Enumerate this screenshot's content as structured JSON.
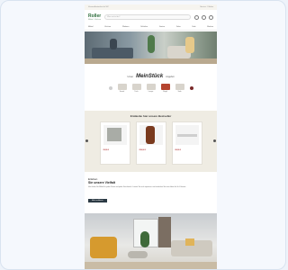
{
  "topbar": {
    "left": "Versandkostenfrei ab 50€",
    "right": "Service · Filialen"
  },
  "header": {
    "logo": "Roller",
    "logo_sub": "Möbel · Küchen",
    "search_placeholder": "Was suchst du?"
  },
  "nav": {
    "items": [
      "Möbel",
      "Küchen",
      "Wohnen",
      "Schlafen",
      "Garten",
      "Deko",
      "Sale",
      "Marken"
    ]
  },
  "brand_section": {
    "pre": "Unser",
    "brand": "MeinStück",
    "post": "Angebot",
    "products": [
      {
        "label": "Sessel"
      },
      {
        "label": "Tisch"
      },
      {
        "label": "Lampe"
      },
      {
        "label": "Regal"
      },
      {
        "label": "Sofa"
      }
    ]
  },
  "offers": {
    "title": "Entdecke hier unsere Bestseller",
    "cards": [
      {
        "name": "Fliese Grau 60x60",
        "price": "29,99 €"
      },
      {
        "name": "Relaxsessel Braun",
        "price": "299,00 €"
      },
      {
        "name": "Couchtisch Weiß",
        "price": "89,99 €"
      }
    ]
  },
  "text_section": {
    "line1": "Erleben",
    "line2": "Sie unsere Vielfalt",
    "paragraph": "Hier finden Sie Möbel für jeden Raum und jeden Geschmack. Lassen Sie sich inspirieren und entdecken Sie neue Ideen für Ihr Zuhause.",
    "button": "Mehr erfahren"
  },
  "colors": {
    "brand": "#2b6b3a",
    "price": "#b03030",
    "beige": "#efece3"
  }
}
